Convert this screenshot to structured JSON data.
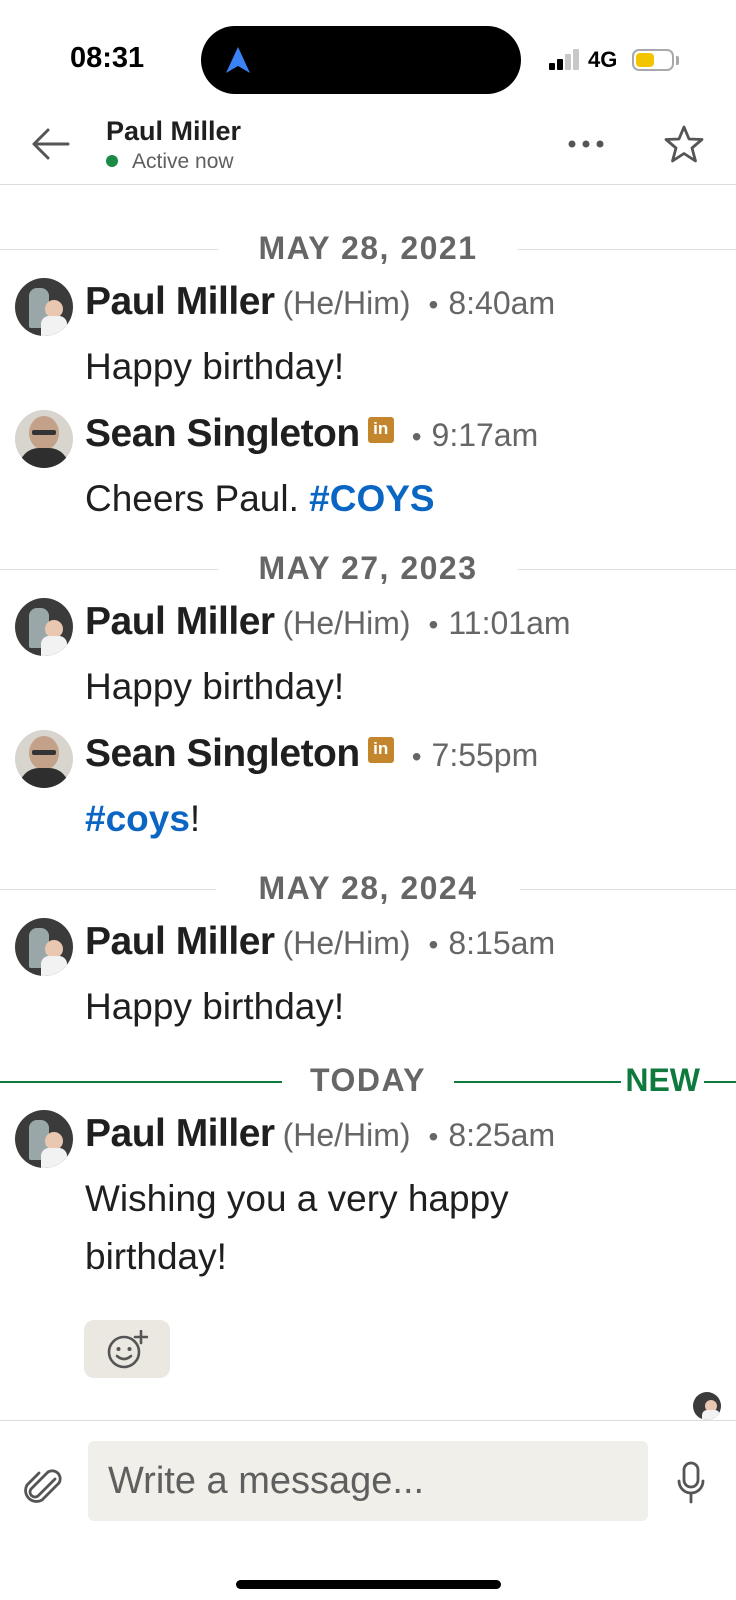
{
  "status_bar": {
    "time": "08:31",
    "network": "4G",
    "icons": [
      "navigation-arrow-icon",
      "signal-icon",
      "battery-icon"
    ]
  },
  "header": {
    "contact_name": "Paul Miller",
    "presence": "Active now",
    "presence_color": "#1a8a47",
    "icons": [
      "back-arrow-icon",
      "more-icon",
      "star-icon"
    ]
  },
  "thread": {
    "separators": [
      {
        "label": "MAY 28, 2021"
      },
      {
        "label": "MAY 27, 2023"
      },
      {
        "label": "MAY 28, 2024"
      },
      {
        "label": "TODAY",
        "badge": "NEW"
      }
    ],
    "messages": [
      {
        "sender": "Paul Miller",
        "pronouns": "(He/Him)",
        "time": "8:40am",
        "text": "Happy birthday!"
      },
      {
        "sender": "Sean Singleton",
        "badge": "in",
        "time": "9:17am",
        "text": "Cheers Paul. ",
        "hashtag": "#COYS",
        "trailing": ""
      },
      {
        "sender": "Paul Miller",
        "pronouns": "(He/Him)",
        "time": "11:01am",
        "text": "Happy birthday!"
      },
      {
        "sender": "Sean Singleton",
        "badge": "in",
        "time": "7:55pm",
        "text": "",
        "hashtag": "#coys",
        "trailing": "!"
      },
      {
        "sender": "Paul Miller",
        "pronouns": "(He/Him)",
        "time": "8:15am",
        "text": "Happy birthday!"
      },
      {
        "sender": "Paul Miller",
        "pronouns": "(He/Him)",
        "time": "8:25am",
        "text": "Wishing you a very happy birthday!"
      }
    ],
    "dot": "•"
  },
  "composer": {
    "placeholder": "Write a message..."
  },
  "colors": {
    "accent_new": "#0f7a3e",
    "hashtag": "#0a66c2",
    "premium_badge": "#c3862c"
  }
}
